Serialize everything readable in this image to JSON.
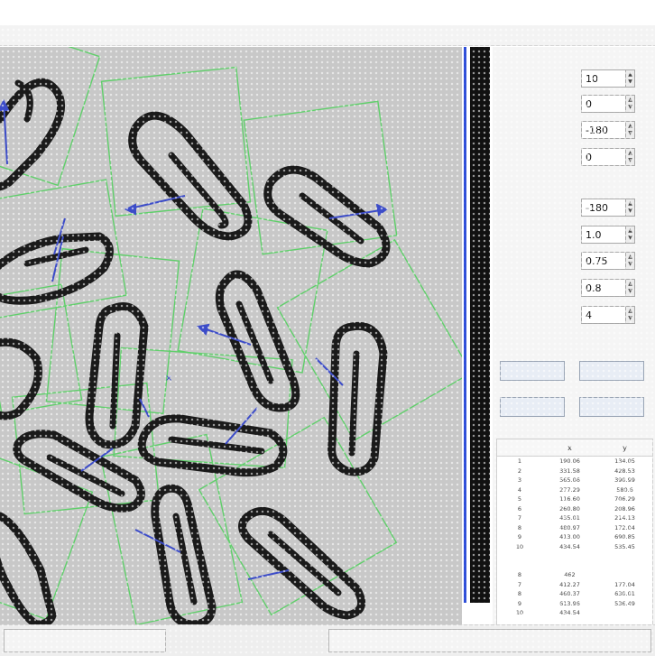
{
  "menu": [
    "",
    "",
    "",
    ""
  ],
  "status_text": "",
  "groups": {
    "template_params_title": "",
    "match_params_title": "",
    "template_ops_title": ""
  },
  "template_params": [
    {
      "label": "",
      "value": "10"
    },
    {
      "label": "",
      "value": "0"
    },
    {
      "label": "",
      "value": "-180"
    },
    {
      "label": "",
      "value": "0"
    }
  ],
  "match_params": [
    {
      "label": "",
      "value": "-180"
    },
    {
      "label": "",
      "value": "1.0"
    },
    {
      "label": "",
      "value": "0.75"
    },
    {
      "label": "",
      "value": "0.8"
    },
    {
      "label": "",
      "value": "4"
    }
  ],
  "ops_buttons": [
    "",
    "",
    "",
    ""
  ],
  "table": {
    "headers": [
      "",
      "x",
      "y"
    ],
    "rows": [
      [
        "1",
        "190.06",
        "134.05"
      ],
      [
        "2",
        "331.58",
        "428.53"
      ],
      [
        "3",
        "565.06",
        "390.99"
      ],
      [
        "4",
        "277.29",
        "580.6"
      ],
      [
        "5",
        "116.60",
        "706.29"
      ],
      [
        "6",
        "260.80",
        "208.96"
      ],
      [
        "7",
        "435.01",
        "214.13"
      ],
      [
        "8",
        "480.97",
        "172.04"
      ],
      [
        "9",
        "413.00",
        "690.85"
      ],
      [
        "10",
        "434.54",
        "535.45"
      ],
      [
        "",
        "",
        ""
      ],
      [
        "",
        "",
        ""
      ],
      [
        "8",
        "462",
        ""
      ],
      [
        "7",
        "412.27",
        "177.04"
      ],
      [
        "8",
        "460.37",
        "630.01"
      ],
      [
        "9",
        "613.96",
        "536.49"
      ],
      [
        "10",
        "434.54",
        ""
      ]
    ]
  },
  "bottom": {
    "open_label": "",
    "save_label": ""
  }
}
